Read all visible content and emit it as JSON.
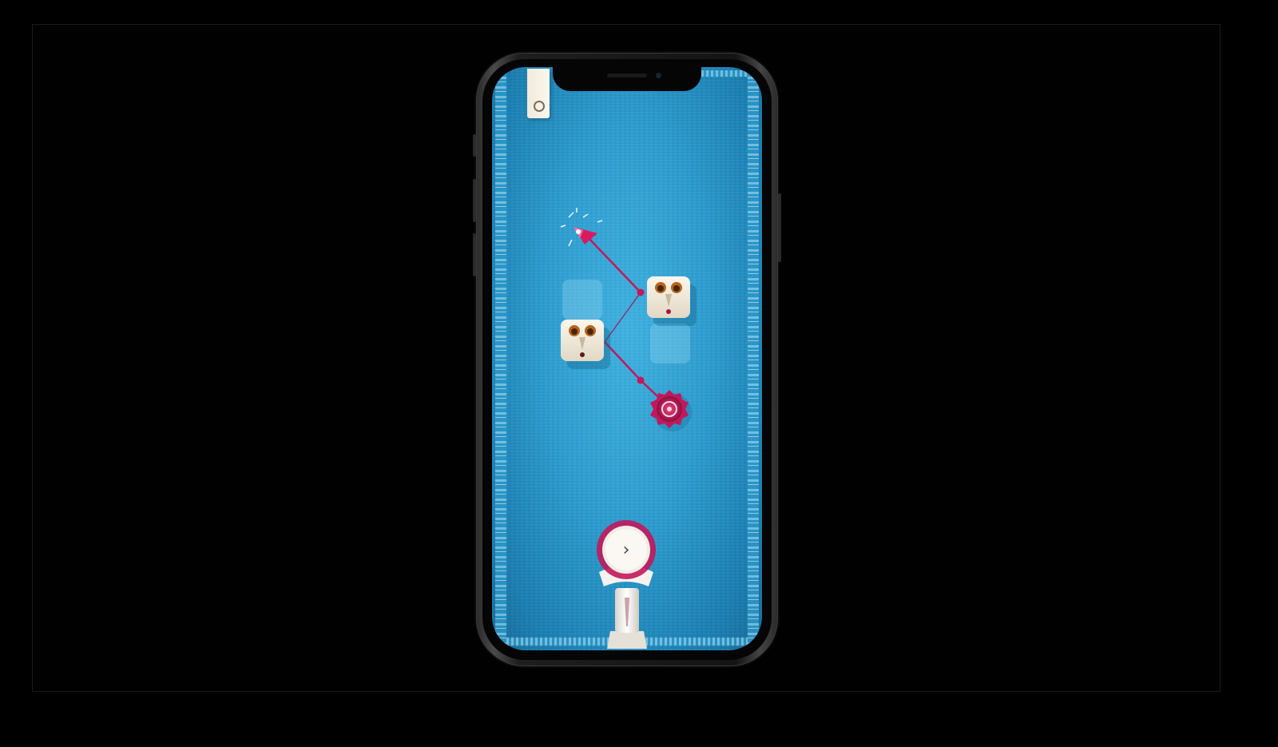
{
  "game": {
    "name": "",
    "pause_icon": "pause-ring-icon",
    "next_button_glyph": "›",
    "next_button_icon": "chevron-right-icon"
  },
  "colors": {
    "background": "#000000",
    "water": "#2b9ccf",
    "laser": "#c2185b",
    "block": "#f3ede2",
    "emitter": "#c2185b",
    "target": "#b0134f"
  },
  "board": {
    "pieces": [
      {
        "id": "emitter",
        "kind": "light-emitter"
      },
      {
        "id": "mask-block-right",
        "kind": "mirror-mask-block"
      },
      {
        "id": "mask-block-left",
        "kind": "mirror-mask-block"
      },
      {
        "id": "empty-slot-1",
        "kind": "empty-tile"
      },
      {
        "id": "empty-slot-2",
        "kind": "empty-tile"
      },
      {
        "id": "target",
        "kind": "spiral-target"
      }
    ]
  }
}
